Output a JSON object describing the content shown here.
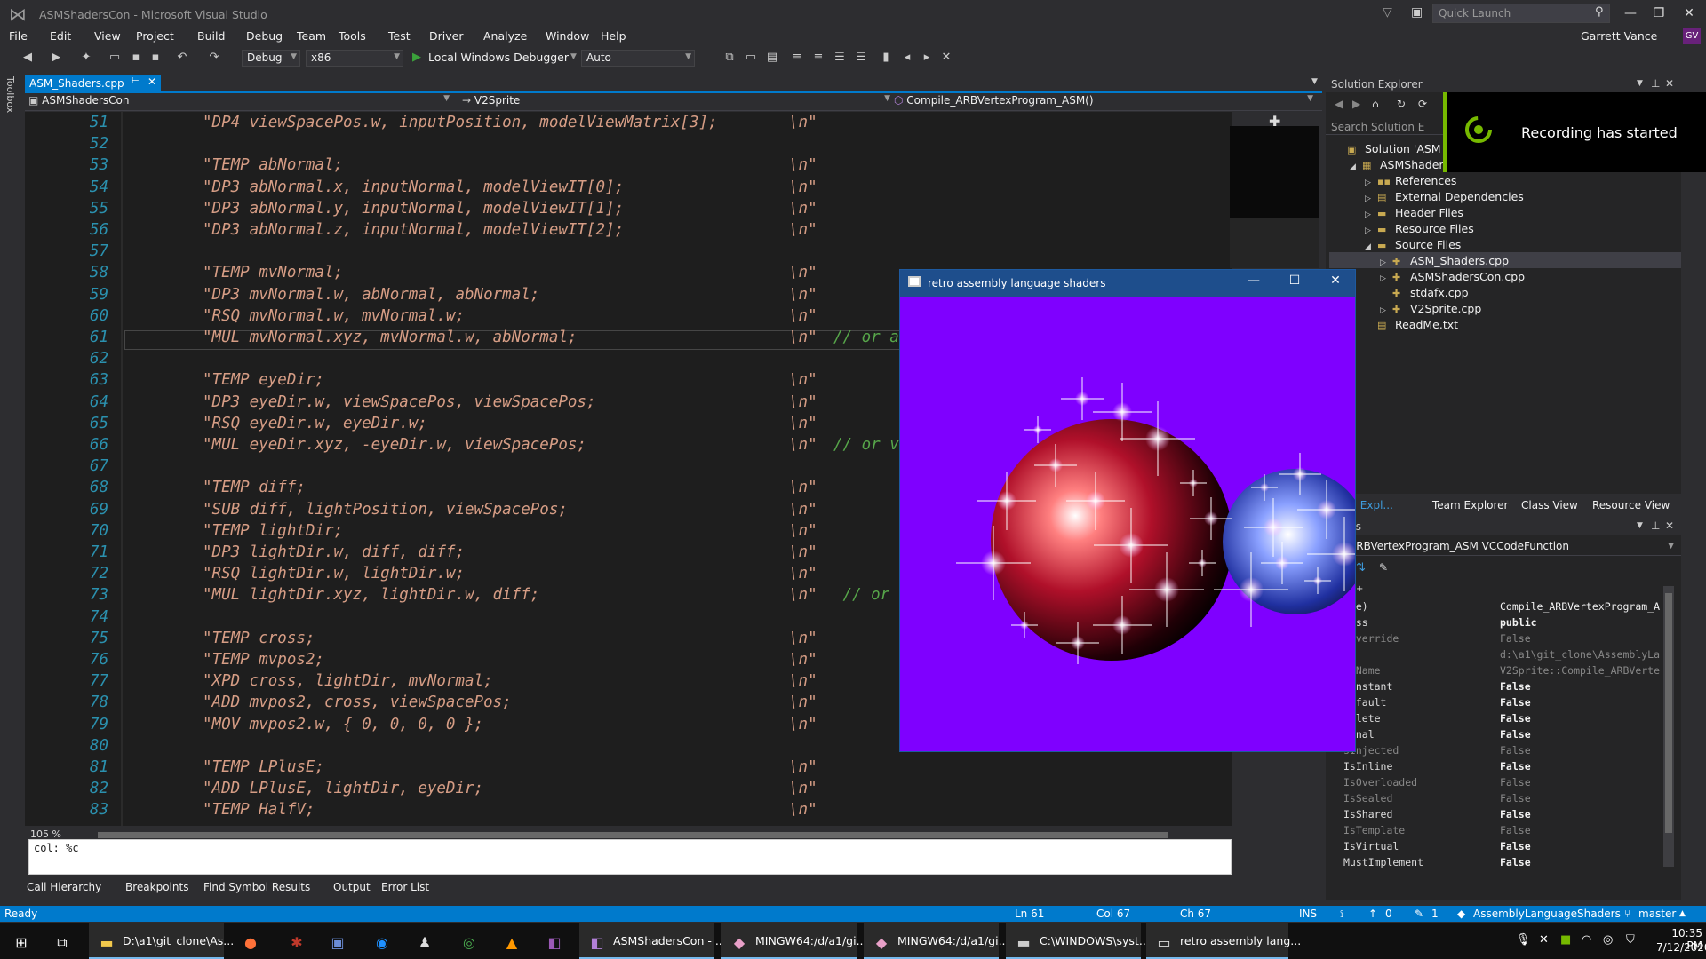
{
  "window": {
    "title": "ASMShadersCon - Microsoft Visual Studio"
  },
  "quick_launch": {
    "placeholder": "Quick Launch"
  },
  "user": {
    "name": "Garrett Vance",
    "initials": "GV"
  },
  "menu": [
    "File",
    "Edit",
    "View",
    "Project",
    "Build",
    "Debug",
    "Team",
    "Tools",
    "Test",
    "Driver",
    "Analyze",
    "Window",
    "Help"
  ],
  "toolbar": {
    "config": "Debug",
    "platform": "x86",
    "debugger": "Local Windows Debugger",
    "auto": "Auto"
  },
  "toolbox_label": "Toolbox",
  "doc_tab": {
    "label": "ASM_Shaders.cpp"
  },
  "nav": {
    "project": "ASMShadersCon",
    "class": "V2Sprite",
    "function": "Compile_ARBVertexProgram_ASM()"
  },
  "code": [
    {
      "ln": "51",
      "text": "\"DP4 viewSpacePos.w, inputPosition, modelViewMatrix[3];",
      "nl": "\\n\"",
      "cmt": ""
    },
    {
      "ln": "52",
      "text": "",
      "nl": "",
      "cmt": ""
    },
    {
      "ln": "53",
      "text": "\"TEMP abNormal;",
      "nl": "\\n\"",
      "cmt": ""
    },
    {
      "ln": "54",
      "text": "\"DP3 abNormal.x, inputNormal, modelViewIT[0];",
      "nl": "\\n\"",
      "cmt": ""
    },
    {
      "ln": "55",
      "text": "\"DP3 abNormal.y, inputNormal, modelViewIT[1];",
      "nl": "\\n\"",
      "cmt": ""
    },
    {
      "ln": "56",
      "text": "\"DP3 abNormal.z, inputNormal, modelViewIT[2];",
      "nl": "\\n\"",
      "cmt": ""
    },
    {
      "ln": "57",
      "text": "",
      "nl": "",
      "cmt": ""
    },
    {
      "ln": "58",
      "text": "\"TEMP mvNormal;",
      "nl": "\\n\"",
      "cmt": ""
    },
    {
      "ln": "59",
      "text": "\"DP3 mvNormal.w, abNormal, abNormal;",
      "nl": "\\n\"",
      "cmt": ""
    },
    {
      "ln": "60",
      "text": "\"RSQ mvNormal.w, mvNormal.w;",
      "nl": "\\n\"",
      "cmt": ""
    },
    {
      "ln": "61",
      "text": "\"MUL mvNormal.xyz, mvNormal.w, abNormal;",
      "nl": "\\n\"",
      "cmt": "// or a"
    },
    {
      "ln": "62",
      "text": "",
      "nl": "",
      "cmt": ""
    },
    {
      "ln": "63",
      "text": "\"TEMP eyeDir;",
      "nl": "\\n\"",
      "cmt": ""
    },
    {
      "ln": "64",
      "text": "\"DP3 eyeDir.w, viewSpacePos, viewSpacePos;",
      "nl": "\\n\"",
      "cmt": ""
    },
    {
      "ln": "65",
      "text": "\"RSQ eyeDir.w, eyeDir.w;",
      "nl": "\\n\"",
      "cmt": ""
    },
    {
      "ln": "66",
      "text": "\"MUL eyeDir.xyz, -eyeDir.w, viewSpacePos;",
      "nl": "\\n\"",
      "cmt": "// or v"
    },
    {
      "ln": "67",
      "text": "",
      "nl": "",
      "cmt": ""
    },
    {
      "ln": "68",
      "text": "\"TEMP diff;",
      "nl": "\\n\"",
      "cmt": ""
    },
    {
      "ln": "69",
      "text": "\"SUB diff, lightPosition, viewSpacePos;",
      "nl": "\\n\"",
      "cmt": ""
    },
    {
      "ln": "70",
      "text": "\"TEMP lightDir;",
      "nl": "\\n\"",
      "cmt": ""
    },
    {
      "ln": "71",
      "text": "\"DP3 lightDir.w, diff, diff;",
      "nl": "\\n\"",
      "cmt": ""
    },
    {
      "ln": "72",
      "text": "\"RSQ lightDir.w, lightDir.w;",
      "nl": "\\n\"",
      "cmt": ""
    },
    {
      "ln": "73",
      "text": "\"MUL lightDir.xyz, lightDir.w, diff;",
      "nl": "\\n\"",
      "cmt": " // or c"
    },
    {
      "ln": "74",
      "text": "",
      "nl": "",
      "cmt": ""
    },
    {
      "ln": "75",
      "text": "\"TEMP cross;",
      "nl": "\\n\"",
      "cmt": ""
    },
    {
      "ln": "76",
      "text": "\"TEMP mvpos2;",
      "nl": "\\n\"",
      "cmt": ""
    },
    {
      "ln": "77",
      "text": "\"XPD cross, lightDir, mvNormal;",
      "nl": "\\n\"",
      "cmt": ""
    },
    {
      "ln": "78",
      "text": "\"ADD mvpos2, cross, viewSpacePos;",
      "nl": "\\n\"",
      "cmt": ""
    },
    {
      "ln": "79",
      "text": "\"MOV mvpos2.w, { 0, 0, 0, 0 };",
      "nl": "\\n\"",
      "cmt": ""
    },
    {
      "ln": "80",
      "text": "",
      "nl": "",
      "cmt": ""
    },
    {
      "ln": "81",
      "text": "\"TEMP LPlusE;",
      "nl": "\\n\"",
      "cmt": ""
    },
    {
      "ln": "82",
      "text": "\"ADD LPlusE, lightDir, eyeDir;",
      "nl": "\\n\"",
      "cmt": ""
    },
    {
      "ln": "83",
      "text": "\"TEMP HalfV;",
      "nl": "\\n\"",
      "cmt": ""
    }
  ],
  "editor": {
    "zoom": "105 %",
    "find_text": "col: %c"
  },
  "bottom_tabs": [
    "Call Hierarchy",
    "Breakpoints",
    "Find Symbol Results",
    "Output",
    "Error List"
  ],
  "status": {
    "ready": "Ready",
    "ln": "Ln 61",
    "col": "Col 67",
    "ch": "Ch 67",
    "ins": "INS",
    "up": "0",
    "edits": "1",
    "repo": "AssemblyLanguageShaders",
    "branch": "master"
  },
  "solution_explorer": {
    "title": "Solution Explorer",
    "search": "Search Solution E",
    "items": [
      {
        "label": "Solution 'ASM",
        "level": 0,
        "arrow": "",
        "icon": "▣"
      },
      {
        "label": "ASMShadersC",
        "level": 1,
        "arrow": "◢",
        "icon": "▦"
      },
      {
        "label": "References",
        "level": 2,
        "arrow": "▷",
        "icon": "▪▪"
      },
      {
        "label": "External Dependencies",
        "level": 2,
        "arrow": "▷",
        "icon": "▤"
      },
      {
        "label": "Header Files",
        "level": 2,
        "arrow": "▷",
        "icon": "▬"
      },
      {
        "label": "Resource Files",
        "level": 2,
        "arrow": "▷",
        "icon": "▬"
      },
      {
        "label": "Source Files",
        "level": 2,
        "arrow": "◢",
        "icon": "▬"
      },
      {
        "label": "ASM_Shaders.cpp",
        "level": 3,
        "arrow": "▷",
        "icon": "✚"
      },
      {
        "label": "ASMShadersCon.cpp",
        "level": 3,
        "arrow": "▷",
        "icon": "✚"
      },
      {
        "label": "stdafx.cpp",
        "level": 3,
        "arrow": "",
        "icon": "✚"
      },
      {
        "label": "V2Sprite.cpp",
        "level": 3,
        "arrow": "▷",
        "icon": "✚"
      },
      {
        "label": "ReadMe.txt",
        "level": 2,
        "arrow": "",
        "icon": "▤"
      }
    ]
  },
  "right_tabs": [
    "tion Expl...",
    "Team Explorer",
    "Class View",
    "Resource View"
  ],
  "properties": {
    "title": "erties",
    "object": "ile_ARBVertexProgram_ASM VCCodeFunction",
    "rows": [
      {
        "name": "ame)",
        "value": "Compile_ARBVertexProgram_A",
        "dim": false,
        "bold": false
      },
      {
        "name": "cess",
        "value": "public",
        "dim": false,
        "bold": true
      },
      {
        "name": "nOverride",
        "value": "False",
        "dim": true,
        "bold": false
      },
      {
        "name": "le",
        "value": "d:\\a1\\git_clone\\AssemblyLa",
        "dim": true,
        "bold": false
      },
      {
        "name": "llName",
        "value": "V2Sprite::Compile_ARBVerte",
        "dim": true,
        "bold": false
      },
      {
        "name": "Constant",
        "value": "False",
        "dim": false,
        "bold": true
      },
      {
        "name": "Default",
        "value": "False",
        "dim": false,
        "bold": true
      },
      {
        "name": "Delete",
        "value": "False",
        "dim": false,
        "bold": true
      },
      {
        "name": "Final",
        "value": "False",
        "dim": false,
        "bold": true
      },
      {
        "name": "sInjected",
        "value": "False",
        "dim": true,
        "bold": false
      },
      {
        "name": "IsInline",
        "value": "False",
        "dim": false,
        "bold": true
      },
      {
        "name": "IsOverloaded",
        "value": "False",
        "dim": true,
        "bold": false
      },
      {
        "name": "IsSealed",
        "value": "False",
        "dim": true,
        "bold": false
      },
      {
        "name": "IsShared",
        "value": "False",
        "dim": false,
        "bold": true
      },
      {
        "name": "IsTemplate",
        "value": "False",
        "dim": true,
        "bold": false
      },
      {
        "name": "IsVirtual",
        "value": "False",
        "dim": false,
        "bold": true
      },
      {
        "name": "MustImplement",
        "value": "False",
        "dim": false,
        "bold": true
      }
    ]
  },
  "recording": {
    "text": "Recording has started"
  },
  "app_window": {
    "title": "retro assembly language shaders",
    "background": "#7f00ff"
  },
  "taskbar": {
    "items": [
      {
        "label": "D:\\a1\\git_clone\\As...",
        "icon": "▬",
        "color": "#f2c94c"
      },
      {
        "label": "",
        "icon": "●",
        "color": "#ff7139"
      },
      {
        "label": "",
        "icon": "✱",
        "color": "#c0392b"
      },
      {
        "label": "",
        "icon": "▣",
        "color": "#6b8cd6"
      },
      {
        "label": "",
        "icon": "◉",
        "color": "#1e90ff"
      },
      {
        "label": "",
        "icon": "♟",
        "color": "#ddd"
      },
      {
        "label": "",
        "icon": "◎",
        "color": "#4caf50"
      },
      {
        "label": "",
        "icon": "▲",
        "color": "#ff9800"
      },
      {
        "label": "",
        "icon": "◧",
        "color": "#9b59b6"
      },
      {
        "label": "ASMShadersCon - ...",
        "icon": "◧",
        "color": "#b180d7"
      },
      {
        "label": "MINGW64:/d/a1/gi...",
        "icon": "◆",
        "color": "#e8a0c8"
      },
      {
        "label": "MINGW64:/d/a1/gi...",
        "icon": "◆",
        "color": "#e8a0c8"
      },
      {
        "label": "C:\\WINDOWS\\syst...",
        "icon": "▬",
        "color": "#ccc"
      },
      {
        "label": "retro assembly lang...",
        "icon": "▭",
        "color": "#ddd"
      }
    ],
    "time": "10:35 PM",
    "date": "7/12/2020"
  },
  "colors": {
    "accent": "#007acc",
    "editor_bg": "#1e1e1e",
    "string": "#d69d85",
    "line_number": "#2b91af",
    "comment": "#57a64a"
  }
}
